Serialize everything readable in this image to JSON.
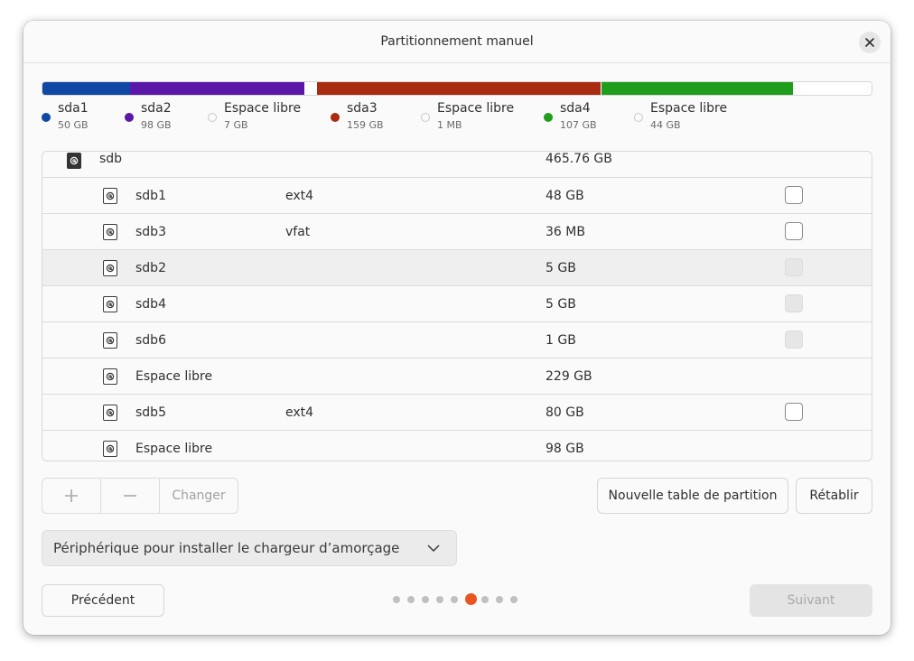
{
  "window": {
    "title": "Partitionnement manuel"
  },
  "usage_bar": [
    {
      "name": "sda1",
      "size": "50 GB",
      "color": "#0f47a5"
    },
    {
      "name": "sda2",
      "size": "98 GB",
      "color": "#5b17a8"
    },
    {
      "name": "Espace libre",
      "size": "7 GB",
      "color": "#ffffff"
    },
    {
      "name": "sda3",
      "size": "159 GB",
      "color": "#a92b10"
    },
    {
      "name": "Espace libre",
      "size": "1 MB",
      "color": "#ffffff"
    },
    {
      "name": "sda4",
      "size": "107 GB",
      "color": "#1e9e1c"
    },
    {
      "name": "Espace libre",
      "size": "44 GB",
      "color": "#ffffff"
    }
  ],
  "table": {
    "disk": {
      "name": "sdb",
      "size": "465.76 GB"
    },
    "partitions": [
      {
        "name": "sdb1",
        "fs": "ext4",
        "size": "48 GB",
        "checkbox": "enabled"
      },
      {
        "name": "sdb3",
        "fs": "vfat",
        "size": "36 MB",
        "checkbox": "enabled"
      },
      {
        "name": "sdb2",
        "fs": "",
        "size": "5 GB",
        "checkbox": "disabled"
      },
      {
        "name": "sdb4",
        "fs": "",
        "size": "5 GB",
        "checkbox": "disabled"
      },
      {
        "name": "sdb6",
        "fs": "",
        "size": "1 GB",
        "checkbox": "disabled"
      },
      {
        "name": "Espace libre",
        "fs": "",
        "size": "229 GB",
        "checkbox": "none"
      },
      {
        "name": "sdb5",
        "fs": "ext4",
        "size": "80 GB",
        "checkbox": "enabled"
      },
      {
        "name": "Espace libre",
        "fs": "",
        "size": "98 GB",
        "checkbox": "none"
      }
    ],
    "selected_row": "sdb2"
  },
  "toolbar": {
    "add_icon": "plus-icon",
    "remove_icon": "minus-icon",
    "change_label": "Changer",
    "new_table_label": "Nouvelle table de partition",
    "revert_label": "Rétablir"
  },
  "bootloader": {
    "label": "Périphérique pour installer le chargeur d’amorçage"
  },
  "footer": {
    "back_label": "Précédent",
    "next_label": "Suivant",
    "pages_total": 9,
    "page_current": 6,
    "accent_color": "#e95420"
  }
}
